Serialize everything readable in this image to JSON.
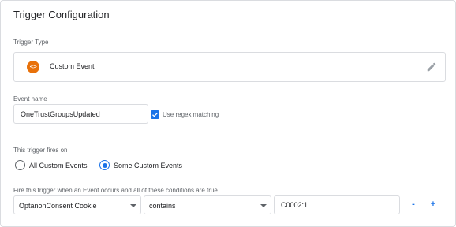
{
  "panel": {
    "title": "Trigger Configuration"
  },
  "trigger_type": {
    "label": "Trigger Type",
    "icon_glyph": "<>",
    "icon_color": "#e8710a",
    "name": "Custom Event",
    "edit_icon": "pencil-icon"
  },
  "event_name": {
    "label": "Event name",
    "value": "OneTrustGroupsUpdated",
    "regex_checkbox_label": "Use regex matching",
    "regex_checked": true
  },
  "fires_on": {
    "label": "This trigger fires on",
    "options": [
      {
        "label": "All Custom Events",
        "selected": false
      },
      {
        "label": "Some Custom Events",
        "selected": true
      }
    ]
  },
  "conditions": {
    "label": "Fire this trigger when an Event occurs and all of these conditions are true",
    "rows": [
      {
        "variable": "OptanonConsent Cookie",
        "operator": "contains",
        "value": "C0002:1",
        "remove_label": "-",
        "add_label": "+"
      }
    ]
  },
  "colors": {
    "accent": "#1a73e8",
    "border": "#dadce0",
    "muted_text": "#5f6368"
  }
}
